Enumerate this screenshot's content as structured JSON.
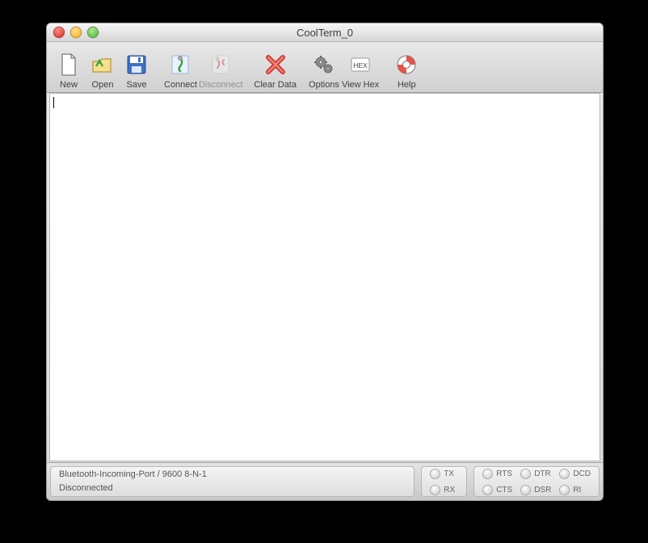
{
  "window": {
    "title": "CoolTerm_0"
  },
  "toolbar": {
    "new": {
      "label": "New"
    },
    "open": {
      "label": "Open"
    },
    "save": {
      "label": "Save"
    },
    "connect": {
      "label": "Connect"
    },
    "disconnect": {
      "label": "Disconnect"
    },
    "clear": {
      "label": "Clear Data"
    },
    "options": {
      "label": "Options"
    },
    "viewhex": {
      "label": "View Hex",
      "badge": "HEX"
    },
    "help": {
      "label": "Help"
    }
  },
  "status": {
    "port_line": "Bluetooth-Incoming-Port / 9600 8-N-1",
    "state_line": "Disconnected",
    "txrx": {
      "tx": "TX",
      "rx": "RX"
    },
    "lines": {
      "rts": "RTS",
      "cts": "CTS",
      "dtr": "DTR",
      "dsr": "DSR",
      "dcd": "DCD",
      "ri": "RI"
    }
  }
}
